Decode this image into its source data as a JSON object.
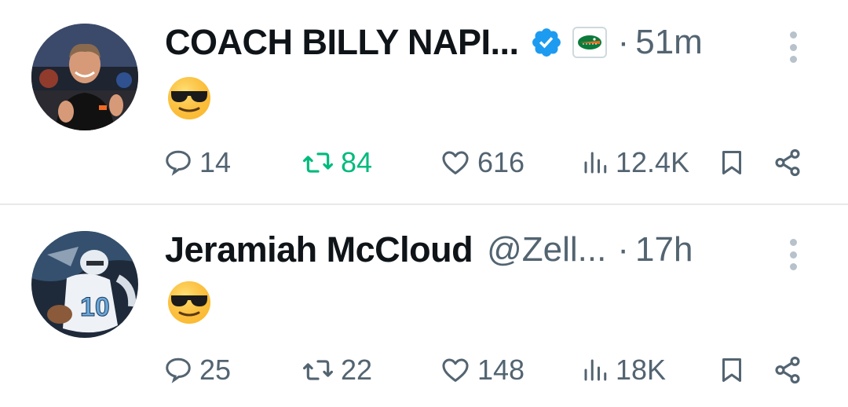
{
  "tweets": [
    {
      "name": "COACH BILLY NAPI...",
      "handle": "",
      "separator": "·",
      "time": "51m",
      "verified": true,
      "affiliation_badge": "gator-logo",
      "content_emoji": "smiling-face-with-sunglasses",
      "counts": {
        "replies": "14",
        "reposts": "84",
        "likes": "616",
        "views": "12.4K"
      },
      "reposted_by_viewer": true,
      "colors": {
        "repost_active": "#00ba7c",
        "verified_blue": "#1d9bf0"
      }
    },
    {
      "name": "Jeramiah McCloud",
      "handle": "@Zell...",
      "separator": "·",
      "time": "17h",
      "verified": false,
      "content_emoji": "smiling-face-with-sunglasses",
      "counts": {
        "replies": "25",
        "reposts": "22",
        "likes": "148",
        "views": "18K"
      },
      "reposted_by_viewer": false
    }
  ],
  "icons": {
    "reply": "reply-icon",
    "repost": "repost-icon",
    "like": "heart-icon",
    "views": "views-icon",
    "bookmark": "bookmark-icon",
    "share": "share-icon",
    "more": "more-icon"
  }
}
